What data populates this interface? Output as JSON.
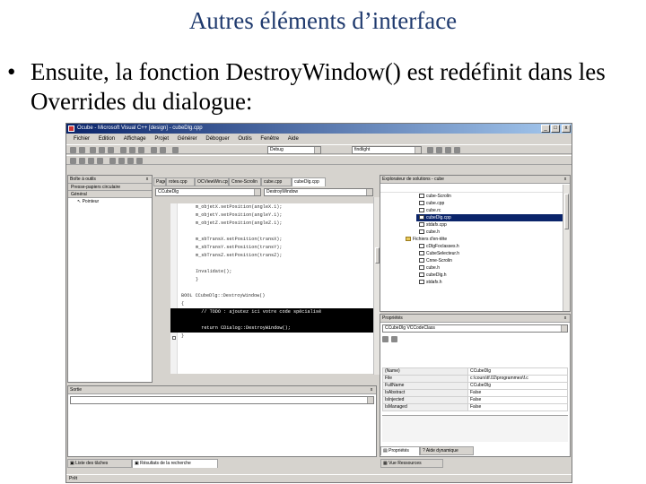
{
  "slide": {
    "title": "Autres éléments d’interface",
    "bullet_symbol": "•",
    "bullet_text": "Ensuite, la fonction DestroyWindow() est redéfinit dans les Overrides du dialogue:"
  },
  "window": {
    "title": "Ocube - Microsoft Visual C++ [design] - cubeDlg.cpp",
    "buttons": {
      "minimize": "_",
      "maximize": "□",
      "close": "x"
    },
    "menu": [
      "Fichier",
      "Edition",
      "Affichage",
      "Projet",
      "Générer",
      "Déboguer",
      "Outils",
      "Fenêtre",
      "Aide"
    ],
    "config_combo": "Debug",
    "find_combo": "findlight"
  },
  "toolbox": {
    "title": "Boîte à outils",
    "section": "Presse-papiers circulaire",
    "group": "Général",
    "item": "Pointeur"
  },
  "editor": {
    "tabs": [
      "Page de démarrage",
      "rotes.cpp",
      "OCViewWin.cpp",
      "Cnne-Scrolin",
      "cube.cpp",
      "cubeDlg.cpp"
    ],
    "class_combo": "CCubeDlg",
    "member_combo": "DestroyWindow",
    "code_lines": [
      "m_objetX.setPosition(angleX.1);",
      "m_objetY.setPosition(angleY.1);",
      "m_objetZ.setPosition(angleZ.1);",
      "",
      "m_sbTransX.setPosition(transX);",
      "m_sbTransY.setPosition(transY);",
      "m_sbTransZ.setPosition(transZ);",
      "",
      "Invalidate();",
      "}",
      "",
      "BOOL CCubeDlg::DestroyWindow()",
      "{",
      "  // TODO : ajoutez ici votre code spécialisé",
      "",
      "  return CDialog::DestroyWindow();",
      "}"
    ]
  },
  "output": {
    "title": "Sortie"
  },
  "solution": {
    "title": "Explorateur de solutions - cube",
    "items": [
      "cube-Scrolin",
      "cube.cpp",
      "cube.rc",
      "cubeDlg.cpp",
      "stdafx.cpp",
      "cube.h",
      "Fichiers d'en-tête",
      "cDlgFoclasses.h",
      "CubeSelecteur.h",
      "Cnne-Scrolin",
      "cube.h",
      "cubeDlg.h",
      "stdafx.h"
    ]
  },
  "properties": {
    "title": "Propriétés",
    "combo": "CCubeDlg  VCCodeClass",
    "rows": [
      [
        "(Name)",
        "CCubeDlg"
      ],
      [
        "File",
        "c:\\cours\\tf.02\\programmes\\f.c"
      ],
      [
        "FullName",
        "CCubeDlg"
      ],
      [
        "IsAbstract",
        "False"
      ],
      [
        "IsInjected",
        "False"
      ],
      [
        "IsManaged",
        "False"
      ]
    ],
    "tabs": [
      "Propriétés",
      "Aide dynamique"
    ]
  },
  "bottom_tabs": {
    "left": [
      "Liste des tâches",
      "Résultats de la recherche"
    ],
    "right": "Vue Ressources"
  },
  "status": {
    "text": "Prêt"
  }
}
